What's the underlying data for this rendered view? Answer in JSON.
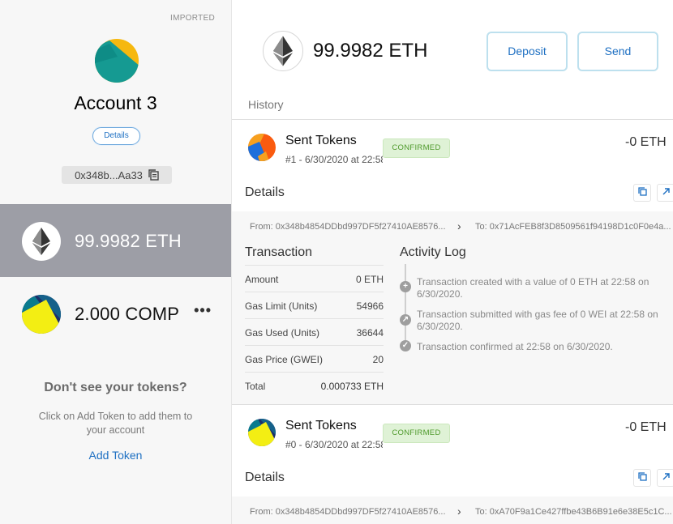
{
  "sidebar": {
    "account_type": "IMPORTED",
    "account_name": "Account 3",
    "details_label": "Details",
    "address_short": "0x348b...Aa33",
    "tokens": [
      {
        "amount": "99.9982 ETH",
        "icon": "ethereum-icon",
        "selected": true
      },
      {
        "amount": "2.000 COMP",
        "icon": "comp-identicon",
        "selected": false,
        "menu": "•••"
      }
    ],
    "dont_see_title": "Don't see your tokens?",
    "dont_see_text": "Click on Add Token to add them to your account",
    "add_token_label": "Add Token"
  },
  "main": {
    "balance": "99.9982 ETH",
    "deposit_label": "Deposit",
    "send_label": "Send",
    "history_label": "History",
    "transactions": [
      {
        "title": "Sent Tokens",
        "subtitle": "#1 - 6/30/2020 at 22:58",
        "status": "CONFIRMED",
        "amount": "-0 ETH",
        "details_label": "Details",
        "from": "From: 0x348b4854DDbd997DF5f27410AE8576...",
        "to": "To: 0x71AcFEB8f3D8509561f94198D1c0F0e4a...",
        "transaction_label": "Transaction",
        "rows": [
          {
            "key": "Amount",
            "value": "0 ETH"
          },
          {
            "key": "Gas Limit (Units)",
            "value": "54966"
          },
          {
            "key": "Gas Used (Units)",
            "value": "36644"
          },
          {
            "key": "Gas Price (GWEI)",
            "value": "20"
          },
          {
            "key": "Total",
            "value": "0.000733 ETH"
          }
        ],
        "activity_label": "Activity Log",
        "activity": [
          "Transaction created with a value of 0 ETH at 22:58 on 6/30/2020.",
          "Transaction submitted with gas fee of 0 WEI at 22:58 on 6/30/2020.",
          "Transaction confirmed at 22:58 on 6/30/2020."
        ]
      },
      {
        "title": "Sent Tokens",
        "subtitle": "#0 - 6/30/2020 at 22:58",
        "status": "CONFIRMED",
        "amount": "-0 ETH",
        "details_label": "Details",
        "from": "From: 0x348b4854DDbd997DF5f27410AE8576...",
        "to": "To: 0xA70F9a1Ce427ffbe43B6B91e6e38E5c1C..."
      }
    ]
  },
  "colors": {
    "accent": "#1d6fc2",
    "selected_row": "#9d9ea6",
    "confirmed_bg": "#dff2d6",
    "confirmed_text": "#4f9a2c"
  }
}
